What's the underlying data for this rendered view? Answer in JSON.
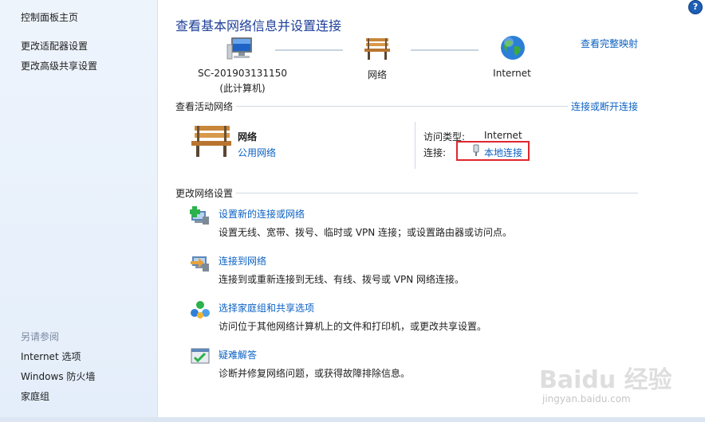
{
  "sidebar": {
    "items": [
      {
        "label": "控制面板主页"
      },
      {
        "label": "更改适配器设置"
      },
      {
        "label": "更改高级共享设置"
      }
    ],
    "see_also_title": "另请参阅",
    "see_also": [
      {
        "label": "Internet 选项"
      },
      {
        "label": "Windows 防火墙"
      },
      {
        "label": "家庭组"
      }
    ]
  },
  "header": {
    "title": "查看基本网络信息并设置连接",
    "full_map_link": "查看完整映射"
  },
  "map": {
    "computer_name": "SC-201903131150",
    "computer_sub": "(此计算机)",
    "network_label": "网络",
    "internet_label": "Internet"
  },
  "active": {
    "section_title": "查看活动网络",
    "connect_link": "连接或断开连接",
    "network_name": "网络",
    "network_type": "公用网络",
    "access_type_label": "访问类型:",
    "access_type_value": "Internet",
    "connections_label": "连接:",
    "connection_value": "本地连接"
  },
  "change": {
    "section_title": "更改网络设置",
    "tasks": [
      {
        "title": "设置新的连接或网络",
        "desc": "设置无线、宽带、拨号、临时或 VPN 连接；或设置路由器或访问点。",
        "icon": "new-connection-icon"
      },
      {
        "title": "连接到网络",
        "desc": "连接到或重新连接到无线、有线、拨号或 VPN 网络连接。",
        "icon": "connect-network-icon"
      },
      {
        "title": "选择家庭组和共享选项",
        "desc": "访问位于其他网络计算机上的文件和打印机，或更改共享设置。",
        "icon": "homegroup-icon"
      },
      {
        "title": "疑难解答",
        "desc": "诊断并修复网络问题，或获得故障排除信息。",
        "icon": "troubleshoot-icon"
      }
    ]
  },
  "help": "?",
  "watermark": {
    "brand": "Baidu 经验",
    "url": "jingyan.baidu.com"
  }
}
